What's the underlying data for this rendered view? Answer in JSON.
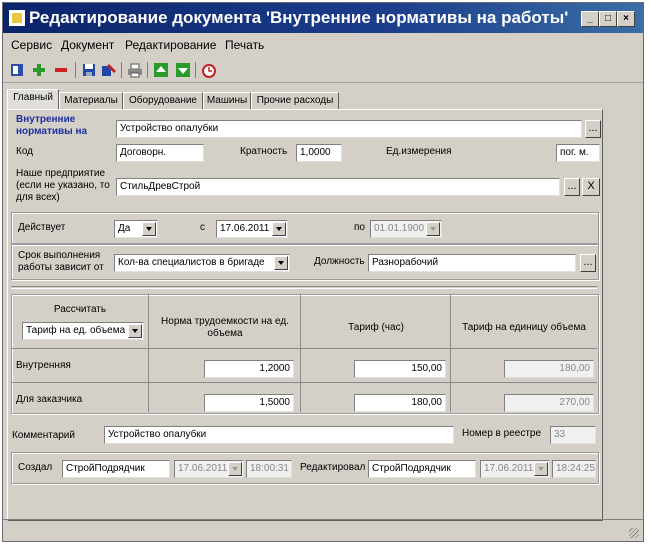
{
  "window": {
    "title": "Редактирование документа 'Внутренние нормативы на работы' по шаб..."
  },
  "menu": {
    "items": [
      "Сервис",
      "Документ",
      "Редактирование",
      "Печать"
    ]
  },
  "toolbar": {
    "icons": [
      "dock-icon",
      "add-icon",
      "remove-icon",
      "save-icon",
      "save-close-icon",
      "print-icon",
      "move-up-icon",
      "move-down-icon",
      "clock-icon"
    ]
  },
  "tabs": [
    {
      "label": "Главный",
      "active": true
    },
    {
      "label": "Материалы",
      "active": false
    },
    {
      "label": "Оборудование",
      "active": false
    },
    {
      "label": "Машины",
      "active": false
    },
    {
      "label": "Прочие расходы",
      "active": false
    }
  ],
  "form": {
    "norms_label": "Внутренние нормативы на",
    "norms_value": "Устройство опалубки",
    "code_label": "Код",
    "code_value": "Договорн.",
    "multiplicity_label": "Кратность",
    "multiplicity_value": "1,0000",
    "unit_label": "Ед.измерения",
    "unit_value": "пог. м.",
    "enterprise_label": "Наше предприятие (если не указано, то для всех)",
    "enterprise_value": "СтильДревСтрой",
    "clear_label": "X",
    "browse_label": "...",
    "active_label": "Действует",
    "active_value": "Да",
    "from_label": "с",
    "from_value": "17.06.2011",
    "to_label": "по",
    "to_value": "01.01.1900",
    "deadline_label": "Срок выполнения работы зависит от",
    "deadline_value": "Кол-ва специалистов в бригаде",
    "position_label": "Должность",
    "position_value": "Разнорабочий"
  },
  "rates": {
    "calc_label": "Рассчитать",
    "calc_value": "Тариф на ед. объема",
    "col_norm": "Норма трудоемкости на ед. объема",
    "col_hour": "Тариф (час)",
    "col_unit": "Тариф на единицу объема",
    "rows": [
      {
        "label": "Внутренняя",
        "norm": "1,2000",
        "hour": "150,00",
        "unit": "180,00"
      },
      {
        "label": "Для заказчика",
        "norm": "1,5000",
        "hour": "180,00",
        "unit": "270,00"
      }
    ]
  },
  "footer": {
    "comment_label": "Комментарий",
    "comment_value": "Устройство опалубки",
    "registry_label": "Номер в реестре",
    "registry_value": "33",
    "created_label": "Создал",
    "created_user": "СтройПодрядчик",
    "created_date": "17.06.2011",
    "created_time": "18:00:31",
    "edited_label": "Редактировал",
    "edited_user": "СтройПодрядчик",
    "edited_date": "17.06.2011",
    "edited_time": "18:24:25"
  }
}
